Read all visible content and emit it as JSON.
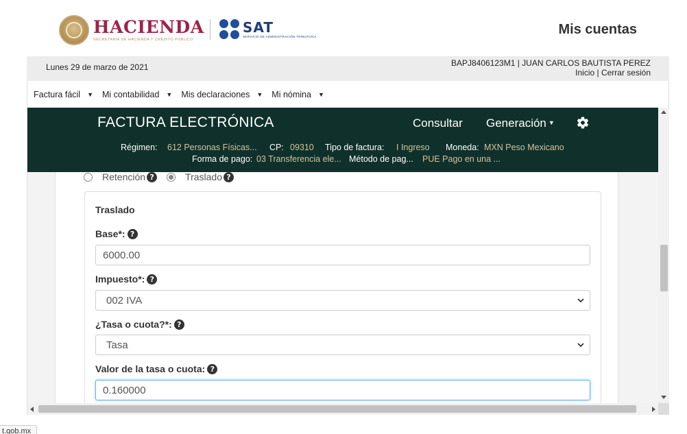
{
  "header": {
    "hacienda_title": "HACIENDA",
    "hacienda_subtitle": "SECRETARÍA DE HACIENDA Y CRÉDITO PÚBLICO",
    "sat_title": "SAT",
    "sat_subtitle": "SERVICIO DE ADMINISTRACIÓN TRIBUTARIA",
    "mis_cuentas": "Mis cuentas"
  },
  "info_bar": {
    "date": "Lunes 29 de marzo de 2021",
    "user": "BAPJ8406123M1 | JUAN CARLOS BAUTISTA PEREZ",
    "inicio": "Inicio",
    "separator": " | ",
    "cerrar_sesion": "Cerrar sesión"
  },
  "menu": {
    "items": [
      {
        "label": "Factura fácil"
      },
      {
        "label": "Mi contabilidad"
      },
      {
        "label": "Mis declaraciones"
      },
      {
        "label": "Mi nómina"
      }
    ]
  },
  "factura": {
    "title": "FACTURA ELECTRÓNICA",
    "nav_consultar": "Consultar",
    "nav_generacion": "Generación",
    "regimen_label": "Régimen:",
    "regimen_value": "612 Personas Físicas...",
    "cp_label": "CP:",
    "cp_value": "09310",
    "tipo_label": "Tipo de factura:",
    "tipo_value": "I Ingreso",
    "moneda_label": "Moneda:",
    "moneda_value": "MXN Peso Mexicano",
    "forma_label": "Forma de pago:",
    "forma_value": "03 Transferencia ele...",
    "metodo_label": "Método de pag...",
    "metodo_value": "PUE Pago en una ..."
  },
  "form": {
    "retencion_label": "Retención",
    "traslado_label": "Traslado",
    "panel_title": "Traslado",
    "base_label": "Base*:",
    "base_value": "6000.00",
    "impuesto_label": "Impuesto*:",
    "impuesto_value": "002 IVA",
    "tasa_label": "¿Tasa o cuota?*:",
    "tasa_value": "Tasa",
    "valor_label": "Valor de la tasa o cuota:",
    "valor_value": "0.160000"
  },
  "status_tip": "t.gob.mx",
  "colors": {
    "brand_dark_green": "#10312b",
    "gold": "#d4c19c",
    "hacienda_red": "#9d2449",
    "sat_blue": "#1f4f9b"
  }
}
